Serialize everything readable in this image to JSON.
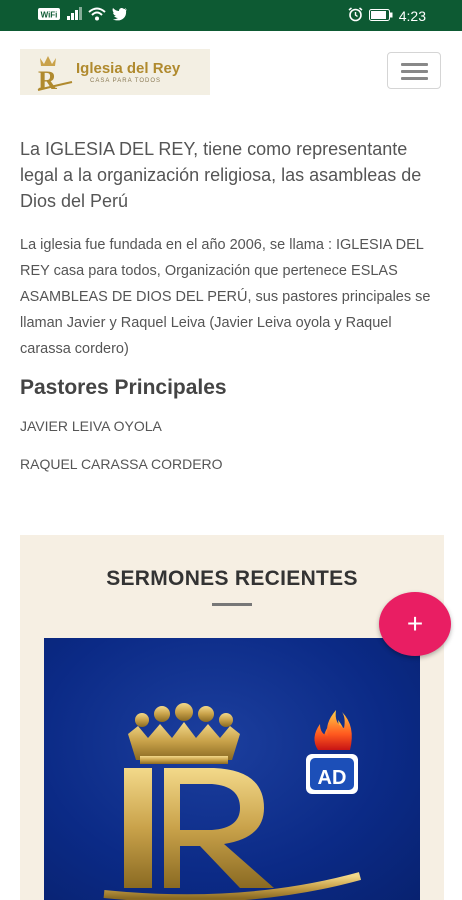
{
  "status_bar": {
    "time": "4:23",
    "icons": [
      "hd-wifi-icon",
      "signal-icon",
      "wifi-icon",
      "twitter-icon",
      "alarm-icon",
      "battery-icon"
    ]
  },
  "header": {
    "logo_title": "Iglesia del Rey",
    "logo_subtitle": "CASA PARA TODOS",
    "menu_icon": "hamburger-icon"
  },
  "content": {
    "lead": "La IGLESIA DEL REY, tiene como representante legal a la organización religiosa, las asambleas de Dios del Perú",
    "paragraph": "La iglesia fue fundada en el año 2006, se llama : IGLESIA DEL REY casa para todos, Organización que pertenece ESLAS ASAMBLEAS DE DIOS DEL PERÚ, sus pastores principales se llaman Javier y Raquel Leiva (Javier Leiva oyola y Raquel carassa cordero)",
    "pastores_title": "Pastores Principales",
    "pastores": [
      "JAVIER LEIVA OYOLA",
      "RAQUEL CARASSA CORDERO"
    ]
  },
  "sermones": {
    "title": "SERMONES RECIENTES",
    "emblem_text": "AD"
  },
  "fab": {
    "label": "+"
  },
  "colors": {
    "status_bar": "#0d5a33",
    "accent": "#e91e63",
    "section_bg": "#f6efe3",
    "gold": "#c9a24a",
    "image_blue": "#0b2a86"
  }
}
